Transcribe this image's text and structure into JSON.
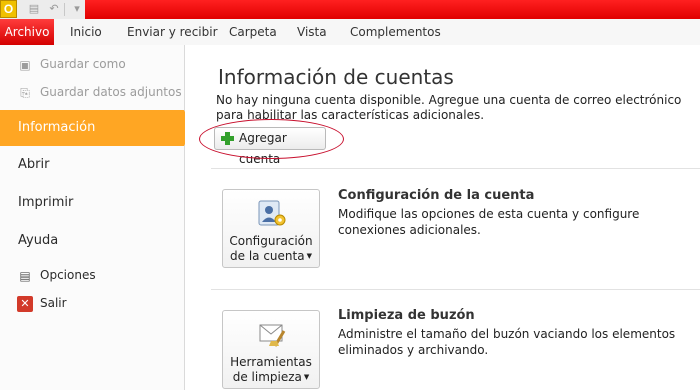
{
  "app_icon": "O",
  "ribbon": {
    "tabs": [
      "Archivo",
      "Inicio",
      "Enviar y recibir",
      "Carpeta",
      "Vista",
      "Complementos"
    ]
  },
  "nav": {
    "guardar_como": "Guardar como",
    "guardar_adjuntos": "Guardar datos adjuntos",
    "informacion": "Información",
    "abrir": "Abrir",
    "imprimir": "Imprimir",
    "ayuda": "Ayuda",
    "opciones": "Opciones",
    "salir": "Salir"
  },
  "main": {
    "title": "Información de cuentas",
    "description": "No hay ninguna cuenta disponible. Agregue una cuenta de correo electrónico para habilitar las características adicionales.",
    "add_account": "Agregar cuenta",
    "account_settings": {
      "button_line1": "Configuración",
      "button_line2": "de la cuenta",
      "title": "Configuración de la cuenta",
      "description": "Modifique las opciones de esta cuenta y configure conexiones adicionales."
    },
    "cleanup": {
      "button_line1": "Herramientas",
      "button_line2": "de limpieza",
      "title": "Limpieza de buzón",
      "description": "Administre el tamaño del buzón vaciando los elementos eliminados y archivando."
    }
  },
  "colors": {
    "file_tab": "#e00000",
    "active_nav": "#ffa623",
    "highlight_ellipse": "#c8102e"
  }
}
